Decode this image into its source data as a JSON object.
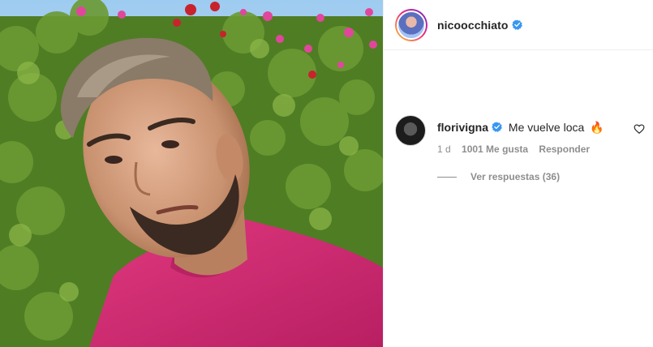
{
  "post": {
    "username": "nicoocchiato",
    "verified": true
  },
  "comment": {
    "username": "florivigna",
    "verified": true,
    "text": "Me vuelve loca",
    "emoji": "🔥",
    "age": "1 d",
    "likes": "1001 Me gusta",
    "reply_label": "Responder",
    "view_replies": "Ver respuestas (36)"
  },
  "colors": {
    "verified_badge": "#3897f0",
    "muted_text": "#8e8e8e",
    "shirt": "#d8327a",
    "foliage": "#5b8a2c"
  },
  "icons": {
    "verified": "verified-badge-icon",
    "like": "heart-outline-icon"
  }
}
